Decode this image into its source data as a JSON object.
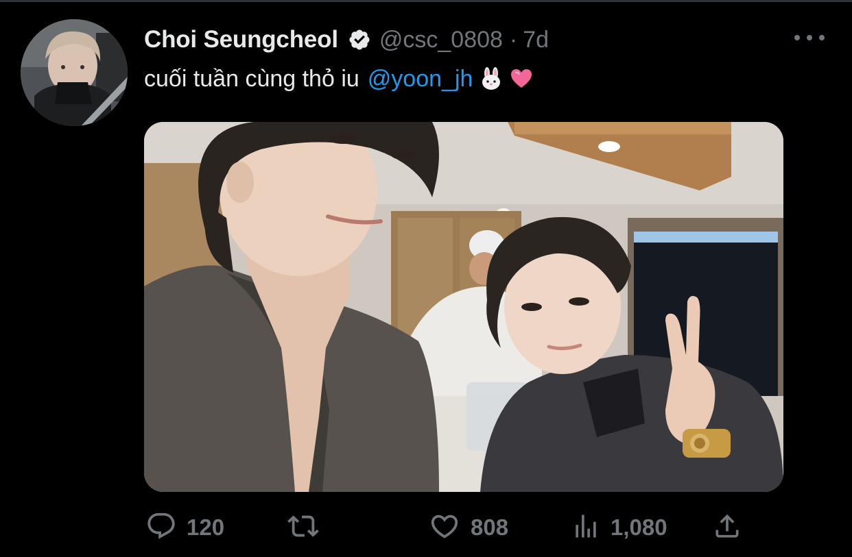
{
  "tweet": {
    "author": {
      "display_name": "Choi Seungcheol",
      "verified": true,
      "handle": "@csc_0808",
      "separator": "·",
      "time_ago": "7d"
    },
    "text": {
      "body": "cuối tuần cùng thỏ iu",
      "mention": "@yoon_jh",
      "emojis": [
        "rabbit-face",
        "pink-heart"
      ]
    },
    "media": {
      "type": "photo"
    },
    "actions": {
      "reply_count": "120",
      "retweet_count": "",
      "like_count": "808",
      "views_count": "1,080"
    }
  },
  "colors": {
    "background": "#000000",
    "primary_text": "#e7e9ea",
    "secondary_text": "#71767b",
    "link": "#1d9bf0",
    "heart_emoji": "#f4669a"
  },
  "icons": {
    "verified": "verified-badge-icon",
    "more": "more-horizontal-icon",
    "reply": "reply-icon",
    "retweet": "retweet-icon",
    "like": "heart-icon",
    "views": "analytics-icon",
    "share": "share-icon"
  }
}
